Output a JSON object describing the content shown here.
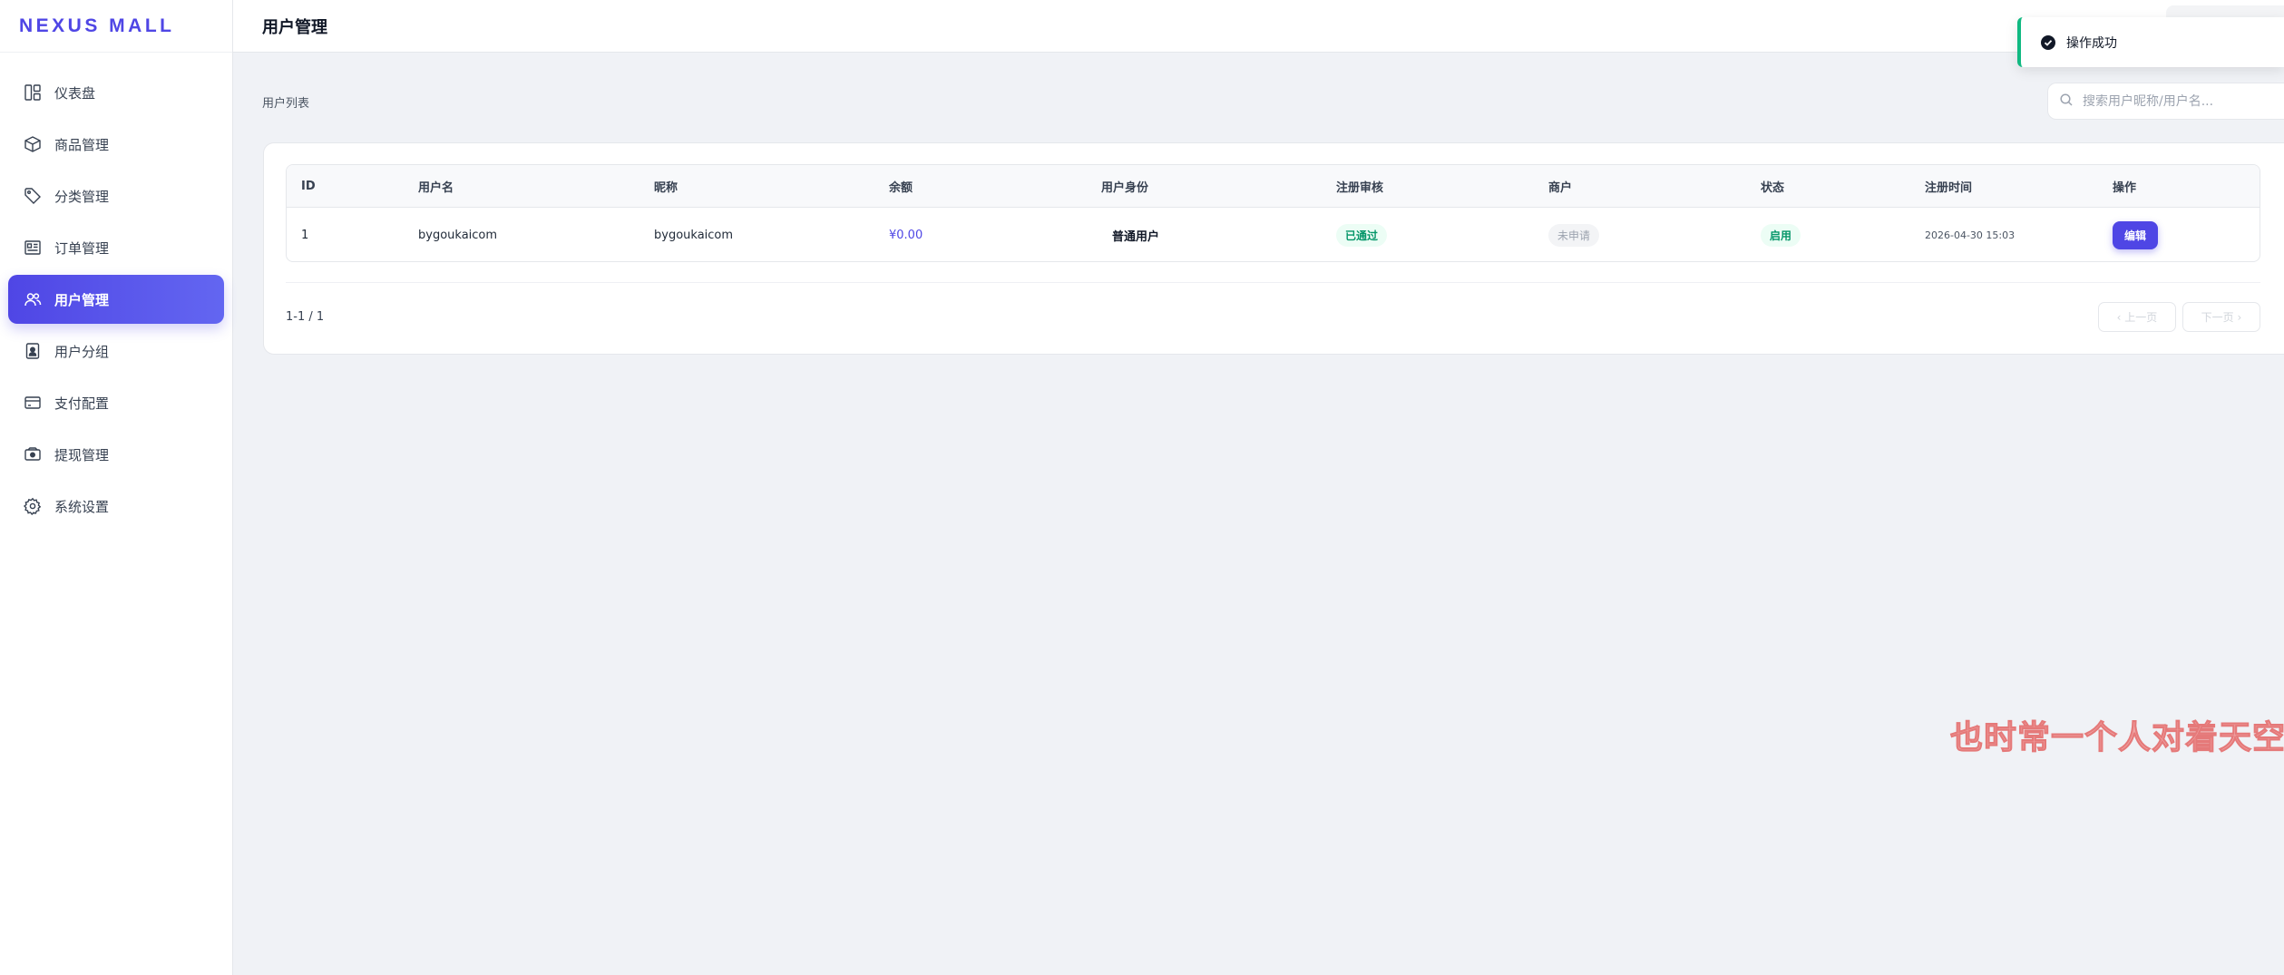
{
  "brand": "NEXUS MALL",
  "sidebar": {
    "items": [
      {
        "label": "仪表盘",
        "icon": "dashboard-icon",
        "active": false
      },
      {
        "label": "商品管理",
        "icon": "box-icon",
        "active": false
      },
      {
        "label": "分类管理",
        "icon": "tag-icon",
        "active": false
      },
      {
        "label": "订单管理",
        "icon": "order-list-icon",
        "active": false
      },
      {
        "label": "用户管理",
        "icon": "users-icon",
        "active": true
      },
      {
        "label": "用户分组",
        "icon": "user-badge-icon",
        "active": false
      },
      {
        "label": "支付配置",
        "icon": "credit-card-icon",
        "active": false
      },
      {
        "label": "提现管理",
        "icon": "cash-icon",
        "active": false
      },
      {
        "label": "系统设置",
        "icon": "gear-icon",
        "active": false
      }
    ]
  },
  "header": {
    "title": "用户管理"
  },
  "toast": {
    "message": "操作成功",
    "icon": "check-circle-icon"
  },
  "main": {
    "list_title": "用户列表",
    "search": {
      "placeholder": "搜索用户昵称/用户名...",
      "value": ""
    },
    "table": {
      "columns": [
        "ID",
        "用户名",
        "昵称",
        "余额",
        "用户身份",
        "注册审核",
        "商户",
        "状态",
        "注册时间",
        "操作"
      ],
      "rows": [
        {
          "id": "1",
          "username": "bygoukaicom",
          "nickname": "bygoukaicom",
          "balance": "¥0.00",
          "identity": "普通用户",
          "review": "已通过",
          "merchant": "未申请",
          "status": "启用",
          "registered": "2026-04-30 15:03",
          "action": "编辑"
        }
      ]
    },
    "pagination": {
      "info": "1-1 / 1",
      "prev": "上一页",
      "next": "下一页"
    }
  },
  "watermark": "也时常一个人对着天空发",
  "colors": {
    "accent": "#4f46e5",
    "success": "#10b981",
    "watermark": "#e57373"
  }
}
